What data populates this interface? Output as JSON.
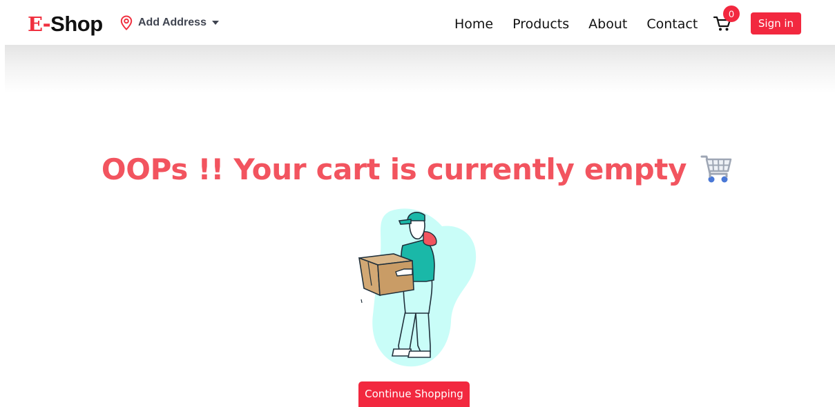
{
  "brand": {
    "e": "E",
    "dash": "-",
    "shop": "Shop",
    "accent": "#f0303f"
  },
  "address": {
    "label": "Add Address",
    "icon": "location-pin-icon"
  },
  "nav": {
    "home": "Home",
    "products": "Products",
    "about": "About",
    "contact": "Contact"
  },
  "cart": {
    "count": "0",
    "icon": "cart-icon"
  },
  "signin": {
    "label": "Sign in"
  },
  "empty_cart": {
    "headline": "OOPs !! Your cart is currently empty",
    "headline_color": "#f2545f",
    "continue_label": "Continue Shopping"
  },
  "colors": {
    "primary": "#f2283f",
    "illustration_blob": "#c9fdf8",
    "illustration_shirt": "#1ab8a8"
  }
}
